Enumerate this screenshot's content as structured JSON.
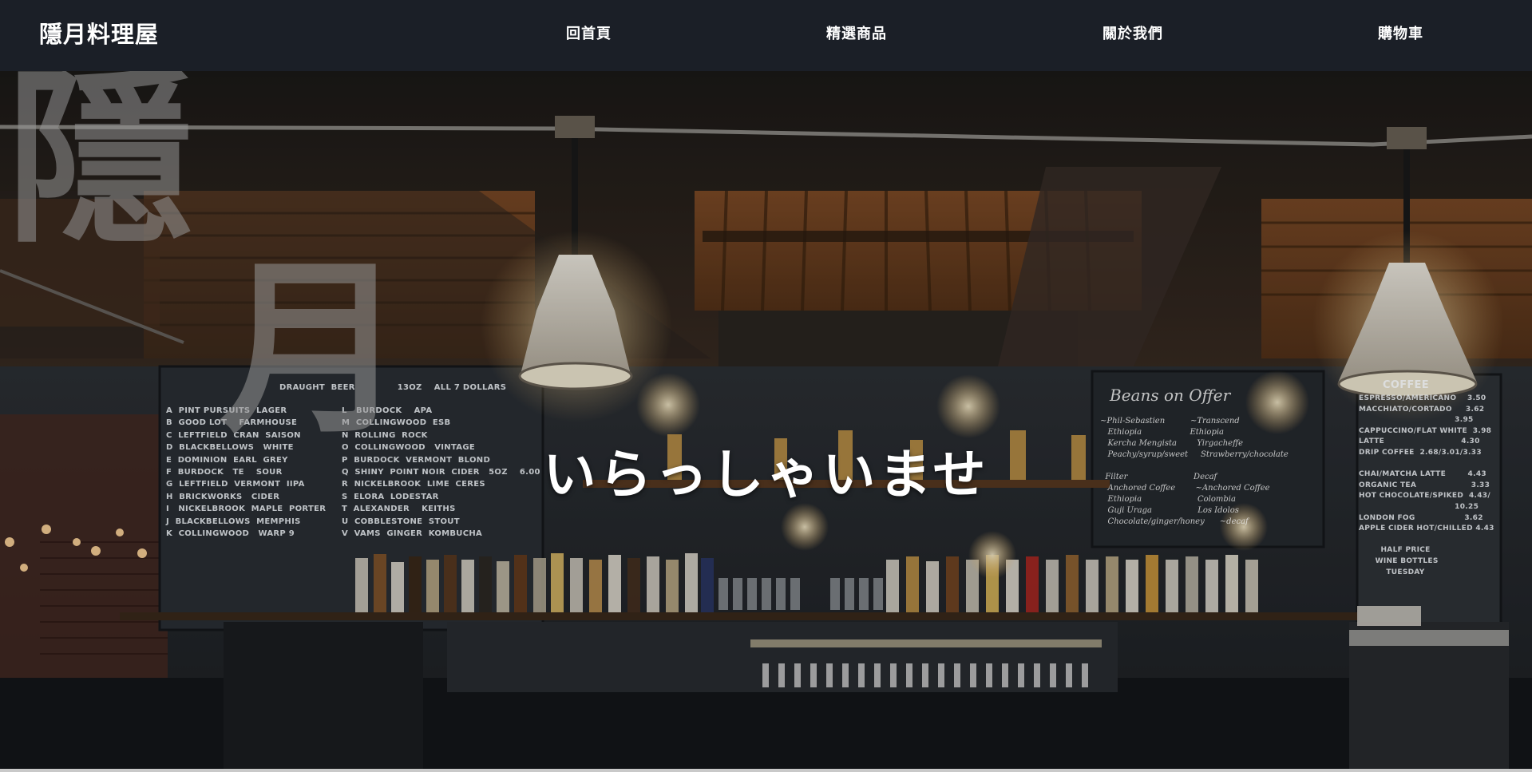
{
  "nav": {
    "brand": "隱月料理屋",
    "links": [
      {
        "label": "回首頁"
      },
      {
        "label": "精選商品"
      },
      {
        "label": "關於我們"
      },
      {
        "label": "購物車"
      }
    ]
  },
  "hero": {
    "background_chars": [
      "隱",
      "月"
    ],
    "welcome_text": "いらっしゃいませ",
    "draught_board": {
      "header": "DRAUGHT  BEER              13OZ    ALL 7 DOLLARS",
      "left_column": "A  PINT PURSUITS  LAGER\nB  GOOD LOT    FARMHOUSE\nC  LEFTFIELD  CRAN  SAISON\nD  BLACKBELLOWS   WHITE\nE  DOMINION  EARL  GREY\nF  BURDOCK   TE    SOUR\nG  LEFTFIELD  VERMONT  IIPA\nH  BRICKWORKS   CIDER\nI   NICKELBROOK  MAPLE  PORTER\nJ  BLACKBELLOWS  MEMPHIS\nK  COLLINGWOOD   WARP 9",
      "right_column": "L   BURDOCK    APA\nM  COLLINGWOOD  ESB\nN  ROLLING  ROCK\nO  COLLINGWOOD   VINTAGE\nP  BURDOCK  VERMONT  BLOND\nQ  SHINY  POINT NOIR  CIDER   5OZ    6.00\nR  NICKELBROOK  LIME  CERES\nS  ELORA  LODESTAR\nT  ALEXANDER    KEITHS\nU  COBBLESTONE  STOUT\nV  VAMS  GINGER  KOMBUCHA"
    },
    "offer_board": {
      "title": "Beans on Offer",
      "text": "~Phil-Sebastien          ~Transcend\n   Ethiopia                   Ethiopia\n   Kercha Mengista        Yirgacheffe\n   Peachy/syrup/sweet     Strawberry/chocolate\n\n  Filter                          Decaf\n   Anchored Coffee        ~Anchored Coffee\n   Ethiopia                      Colombia\n   Guji Uraga                  Los Idolos\n   Chocolate/ginger/honey      ~decaf"
    },
    "coffee_board": {
      "title": "COFFEE",
      "text": "ESPRESSO/AMERICANO    3.50\nMACCHIATO/CORTADO     3.62\n                                   3.95\nCAPPUCCINO/FLAT WHITE  3.98\nLATTE                            4.30\nDRIP COFFEE  2.68/3.01/3.33\n\nCHAI/MATCHA LATTE        4.43\nORGANIC TEA                    3.33\nHOT CHOCOLATE/SPIKED  4.43/\n                                   10.25\nLONDON FOG                  3.62\nAPPLE CIDER HOT/CHILLED 4.43\n\n        HALF PRICE\n      WINE BOTTLES\n          TUESDAY"
    }
  }
}
